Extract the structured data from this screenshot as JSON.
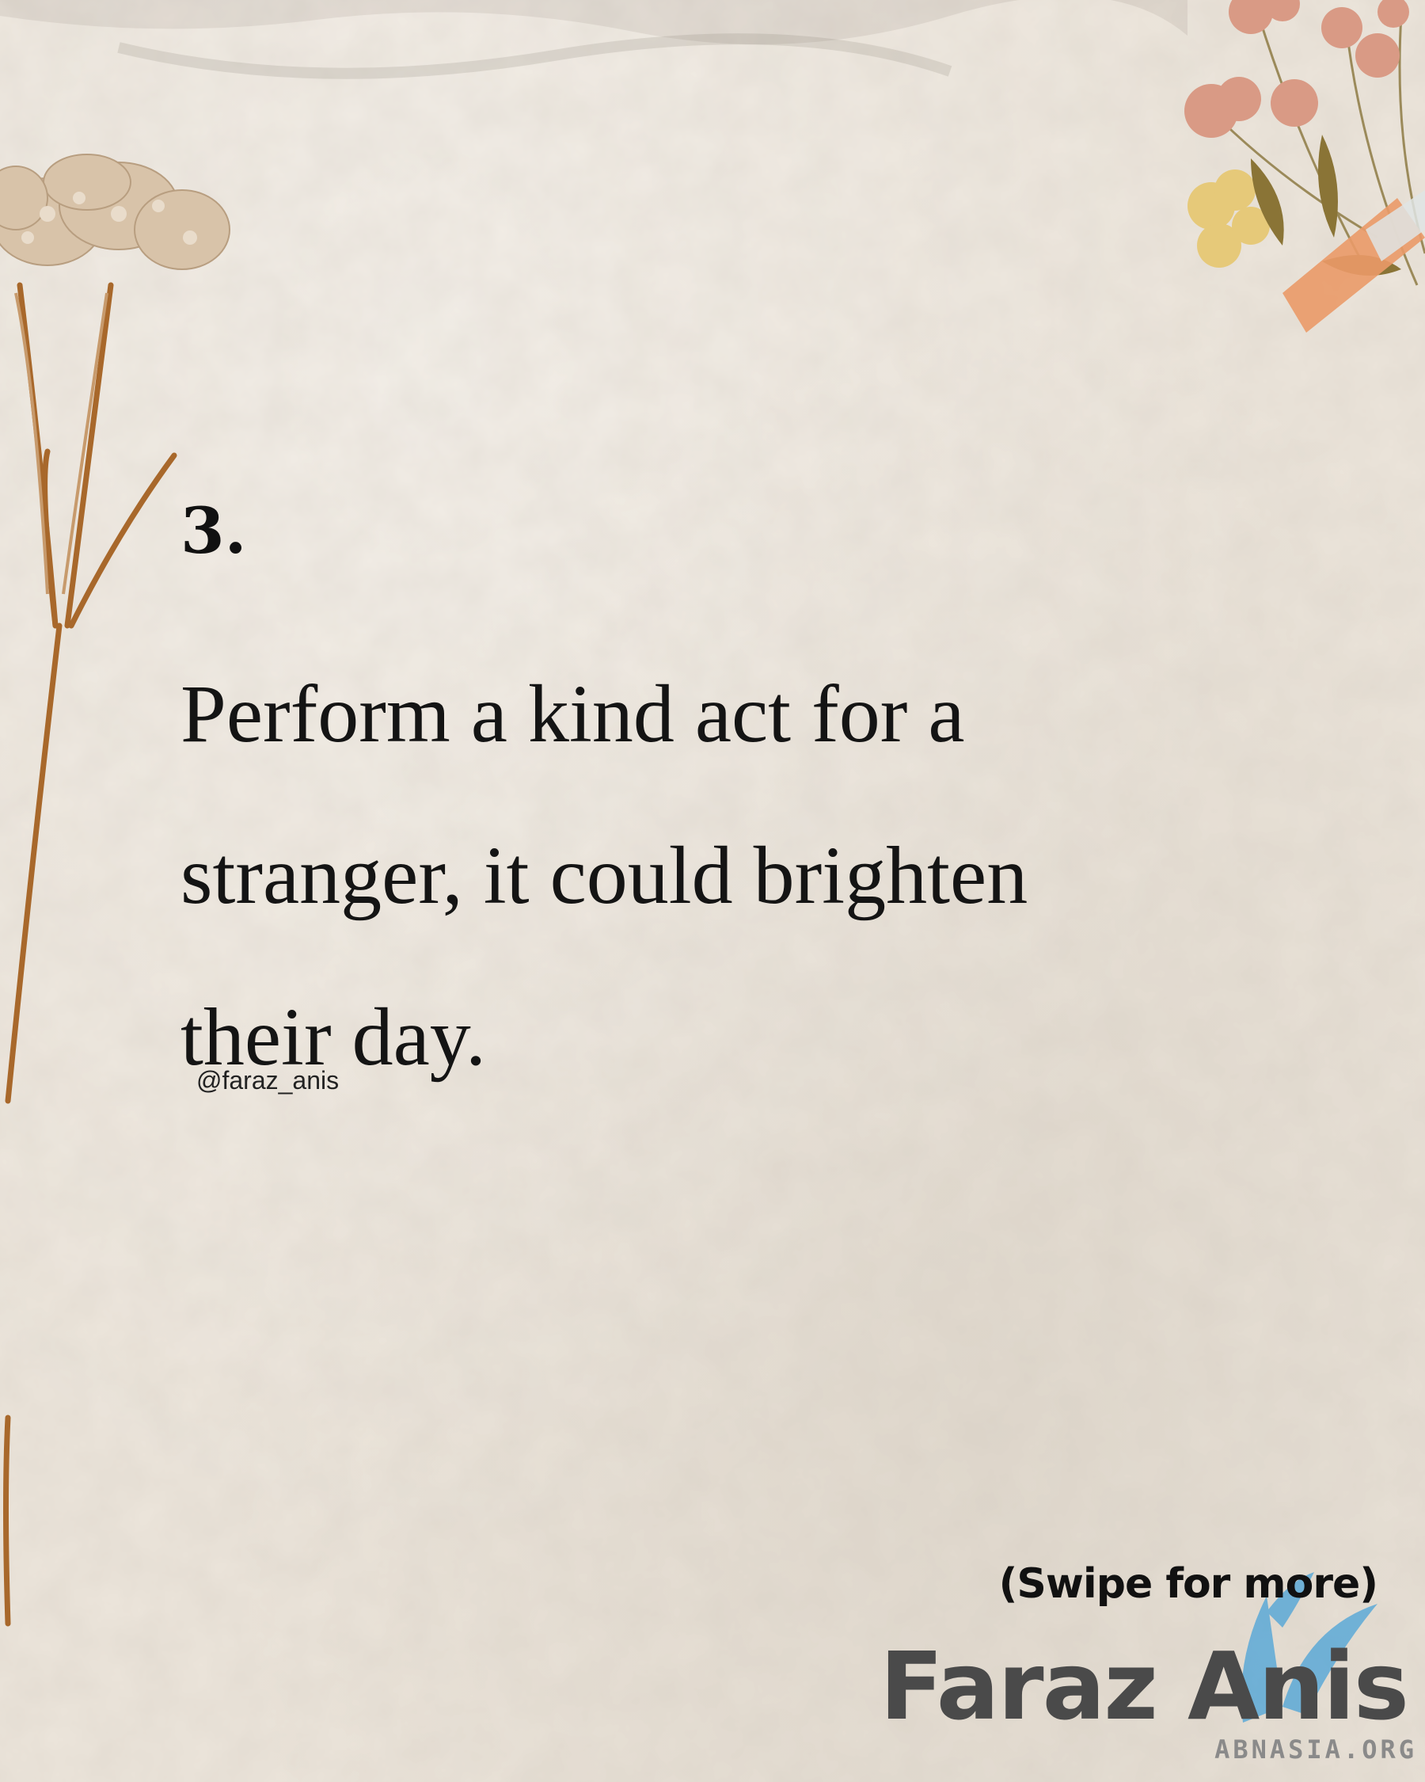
{
  "item_number": "3.",
  "quote_lines": [
    "Perform a kind act for a",
    "stranger, it could brighten",
    "their day."
  ],
  "handle": "@faraz_anis",
  "swipe_hint": "(Swipe for more)",
  "watermark": {
    "name": "Faraz Anis",
    "site": "ABNASIA.ORG"
  },
  "colors": {
    "paper": "#ece5db",
    "text": "#141414",
    "stem": "#a8682b",
    "watermark_blue": "#4aa3d8"
  },
  "icons": [
    "dried-flower-stem-icon",
    "pressed-flowers-bouquet-icon",
    "tape-strip-icon",
    "bird-watermark-icon"
  ]
}
